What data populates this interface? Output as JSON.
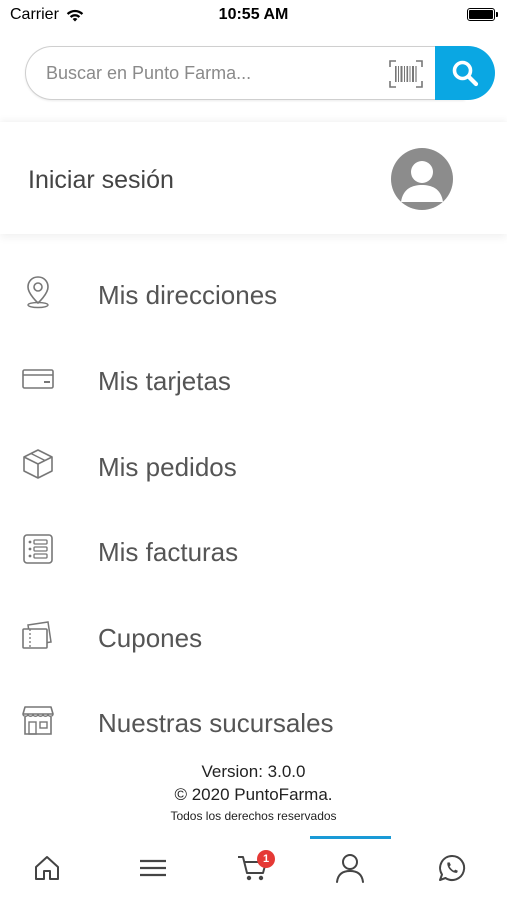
{
  "status": {
    "carrier": "Carrier",
    "time": "10:55 AM",
    "wifi_icon": "wifi-icon",
    "battery_icon": "battery-icon"
  },
  "search": {
    "placeholder": "Buscar en Punto Farma...",
    "value": "",
    "barcode_icon": "barcode-scan-icon",
    "button_icon": "search-icon",
    "accent_color": "#0aa7e3"
  },
  "login": {
    "label": "Iniciar sesión",
    "avatar_icon": "user-avatar-icon"
  },
  "menu": {
    "items": [
      {
        "label": "Mis direcciones",
        "icon": "location-pin-icon"
      },
      {
        "label": "Mis tarjetas",
        "icon": "credit-card-icon"
      },
      {
        "label": "Mis pedidos",
        "icon": "package-box-icon"
      },
      {
        "label": "Mis facturas",
        "icon": "invoice-list-icon"
      },
      {
        "label": "Cupones",
        "icon": "coupon-icon"
      },
      {
        "label": "Nuestras sucursales",
        "icon": "store-icon"
      }
    ]
  },
  "footer": {
    "version": "Version: 3.0.0",
    "copyright": "© 2020 PuntoFarma.",
    "rights": "Todos los derechos reservados"
  },
  "tabbar": {
    "tabs": [
      {
        "name": "home",
        "icon": "home-icon"
      },
      {
        "name": "menu",
        "icon": "hamburger-menu-icon"
      },
      {
        "name": "cart",
        "icon": "cart-icon",
        "badge": "1"
      },
      {
        "name": "account",
        "icon": "user-icon",
        "active": true
      },
      {
        "name": "whatsapp",
        "icon": "whatsapp-icon"
      }
    ],
    "active_color": "#1a9ad6",
    "badge_color": "#e53935"
  }
}
